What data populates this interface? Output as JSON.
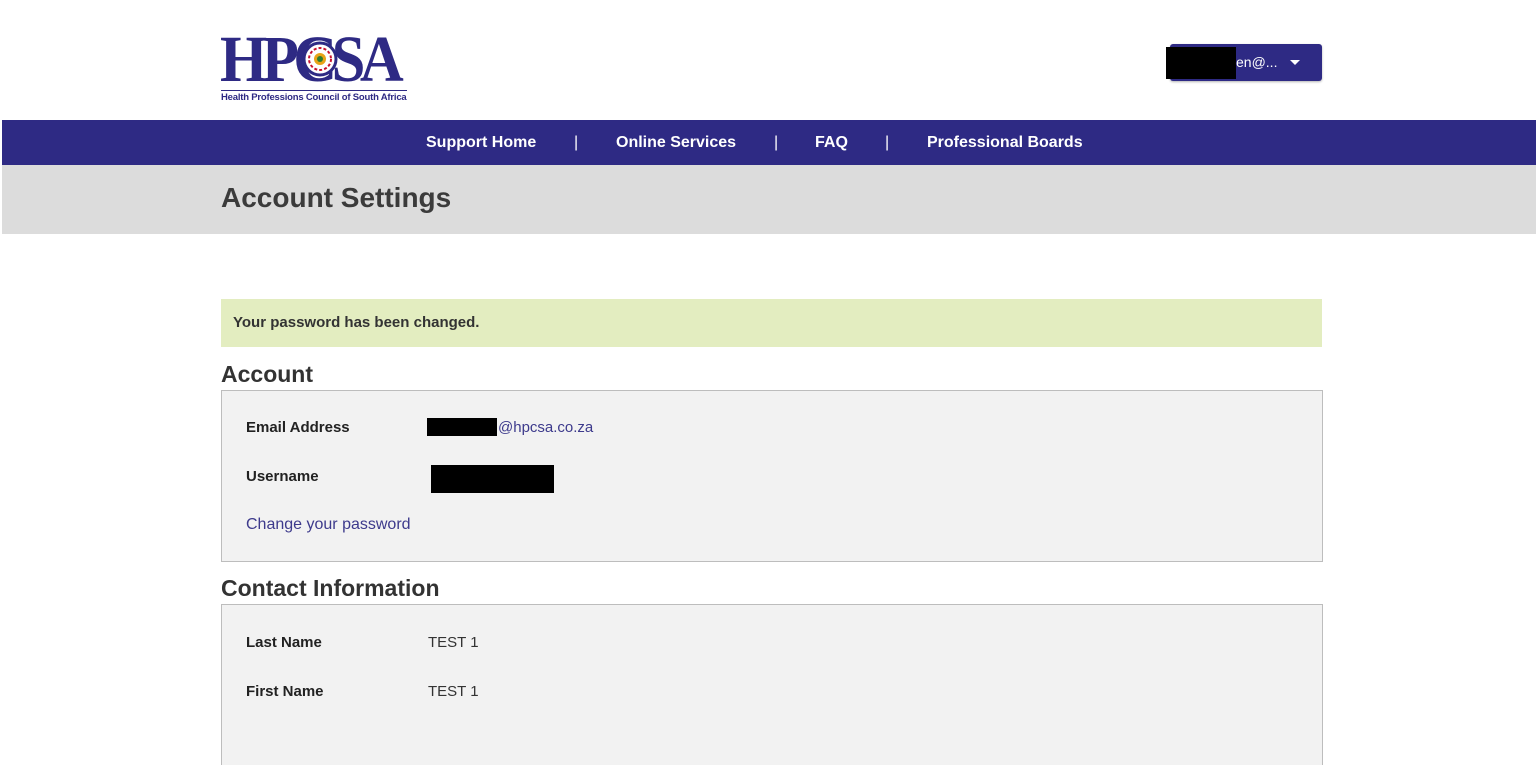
{
  "brand": {
    "logo_text": "HPCSA",
    "logo_subtitle": "Health Professions Council of South Africa",
    "primary_color": "#2e2a84"
  },
  "user_menu": {
    "label": "en@...",
    "caret_icon": "caret-down-icon"
  },
  "nav": {
    "items": [
      "Support Home",
      "Online Services",
      "FAQ",
      "Professional Boards"
    ],
    "separator": "|"
  },
  "page": {
    "title": "Account Settings"
  },
  "alert": {
    "message": "Your password has been changed.",
    "color": "#e3edc0"
  },
  "account": {
    "heading": "Account",
    "email_label": "Email Address",
    "email_value": "@hpcsa.co.za",
    "username_label": "Username",
    "change_password_link": "Change your password"
  },
  "contact": {
    "heading": "Contact Information",
    "last_name_label": "Last Name",
    "last_name_value": "TEST 1",
    "first_name_label": "First Name",
    "first_name_value": "TEST 1"
  }
}
